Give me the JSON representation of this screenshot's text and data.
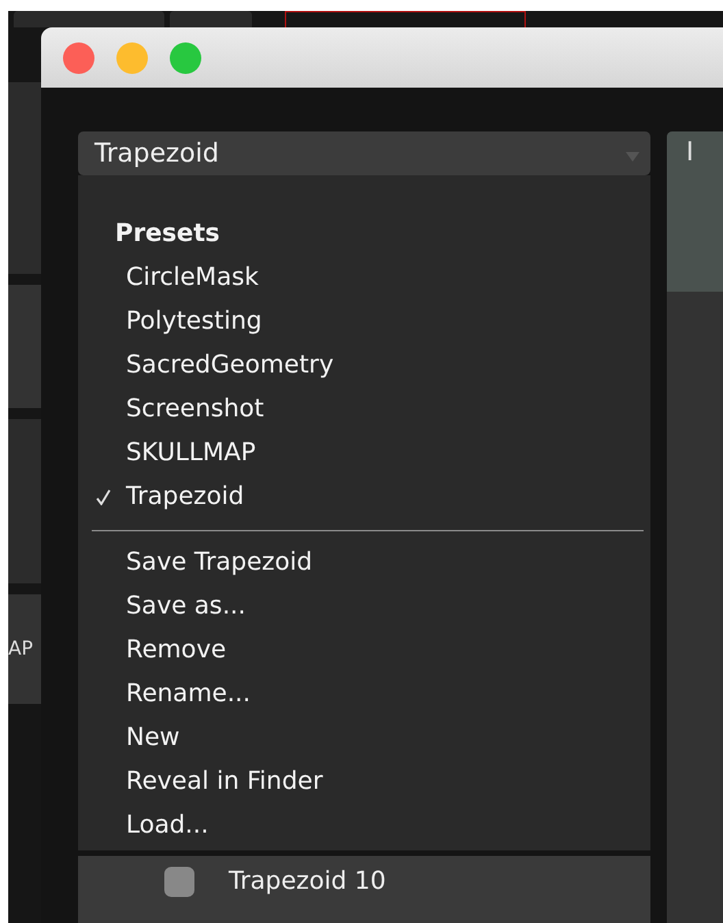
{
  "background_app": {
    "cut_label": "AP"
  },
  "window": {
    "preset_dropdown": {
      "value": "Trapezoid"
    },
    "preset_menu": {
      "header": "Presets",
      "presets": [
        {
          "label": "CircleMask",
          "selected": false
        },
        {
          "label": "Polytesting",
          "selected": false
        },
        {
          "label": "SacredGeometry",
          "selected": false
        },
        {
          "label": "Screenshot",
          "selected": false
        },
        {
          "label": "SKULLMAP",
          "selected": false
        },
        {
          "label": "Trapezoid",
          "selected": true
        }
      ],
      "actions": [
        "Save Trapezoid",
        "Save as...",
        "Remove",
        "Rename...",
        "New",
        "Reveal in Finder",
        "Load..."
      ]
    },
    "list_row": {
      "checked": false,
      "label": "Trapezoid 10"
    },
    "side_panel": {
      "tab_label": "I"
    }
  }
}
